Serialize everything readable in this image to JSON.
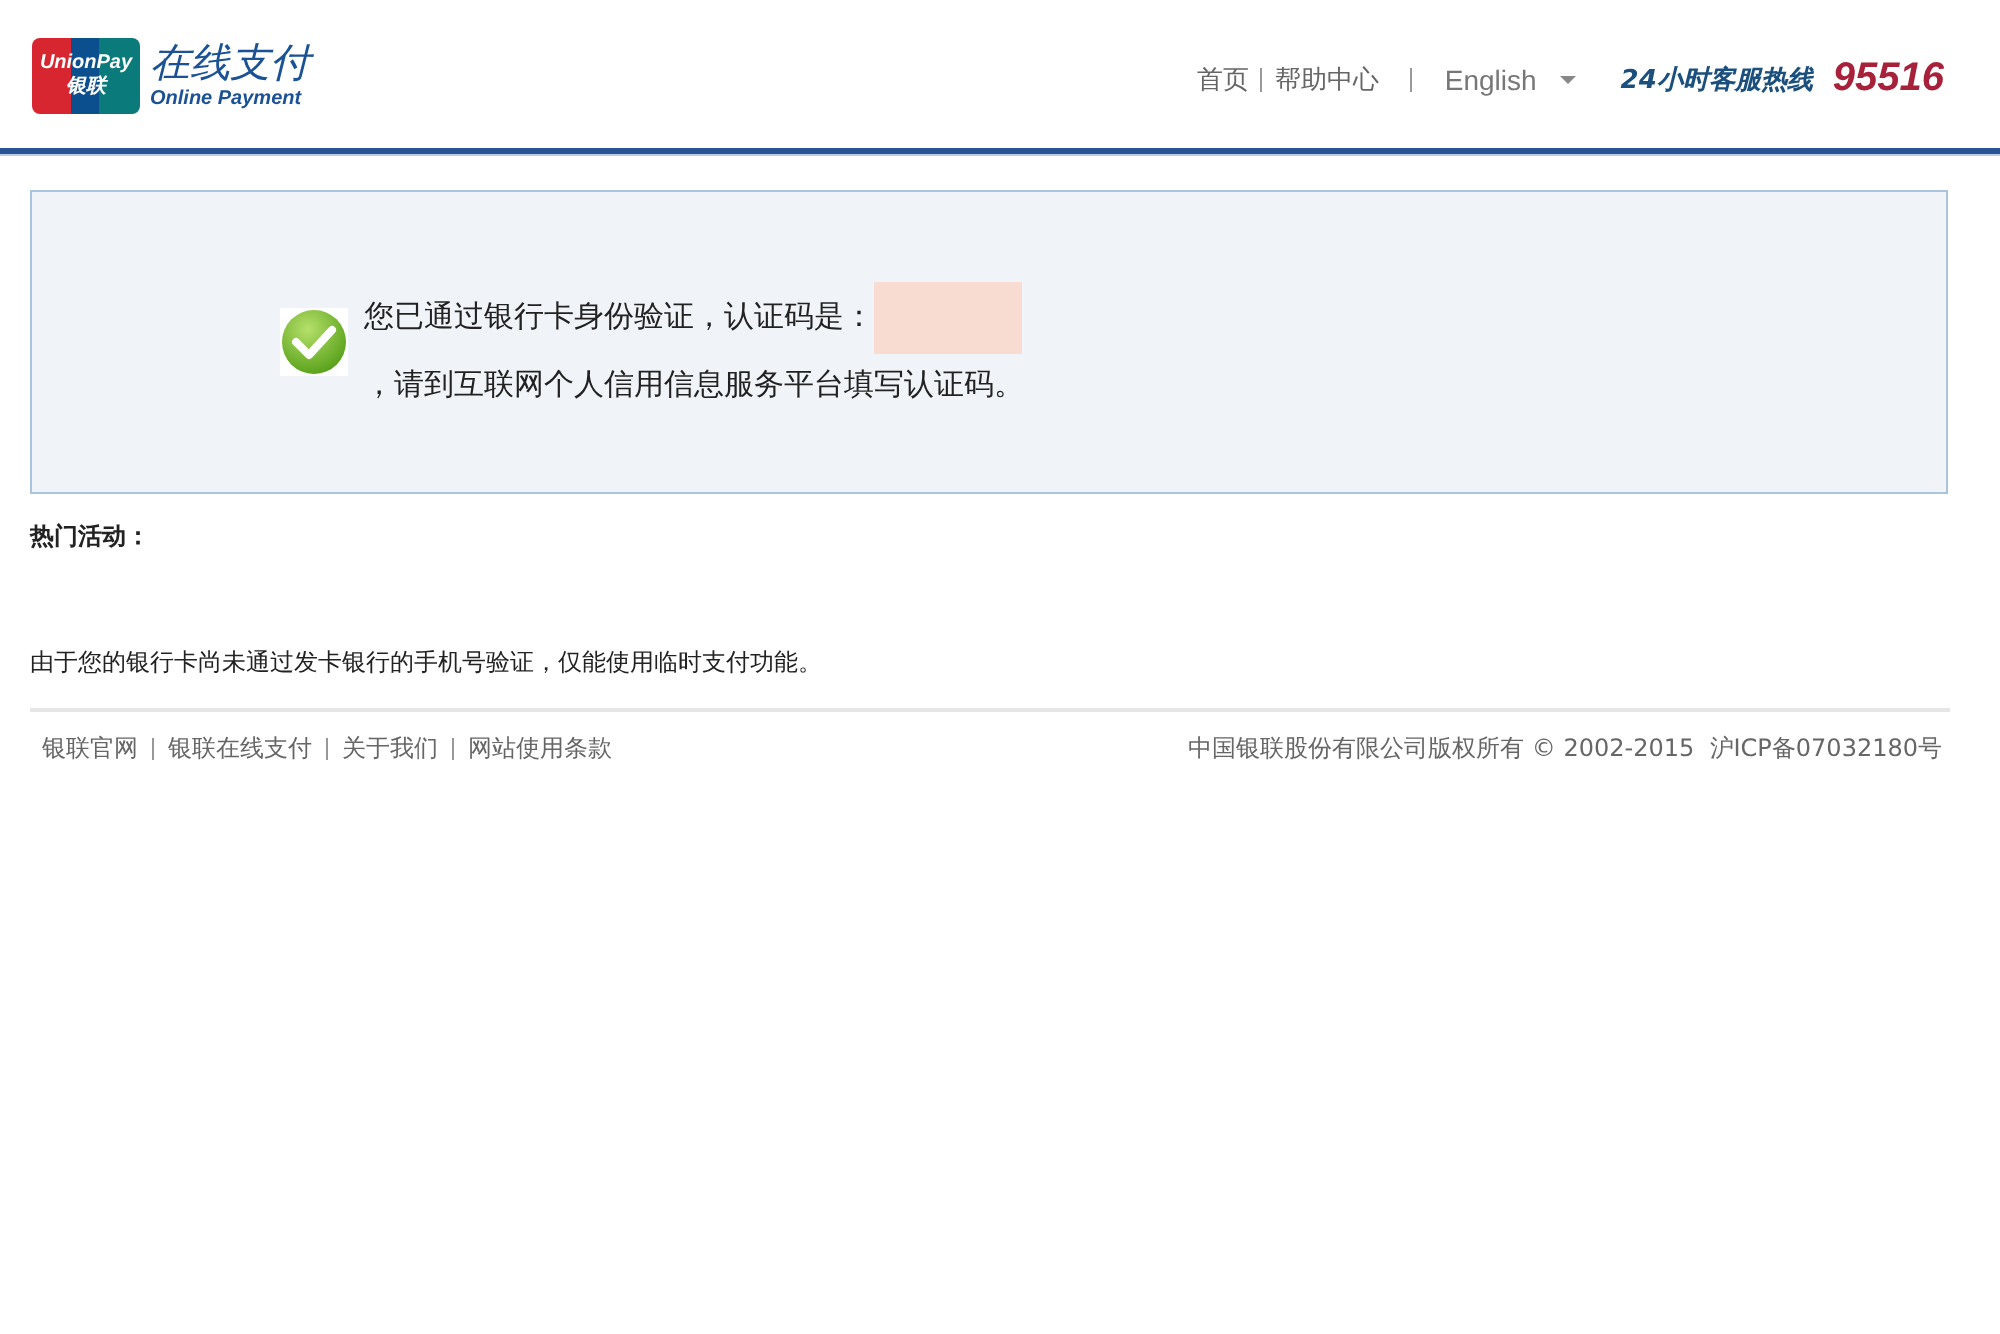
{
  "header": {
    "logo": {
      "card_latin": "UnionPay",
      "card_cjk": "银联",
      "title": "在线支付",
      "subtitle": "Online Payment"
    },
    "nav": [
      {
        "label": "首页"
      },
      {
        "label": "帮助中心"
      }
    ],
    "language": "English",
    "hotline": {
      "label": "24小时客服热线",
      "number": "95516"
    }
  },
  "message": {
    "line1": "您已通过银行卡身份验证，认证码是：",
    "line2": "，请到互联网个人信用信息服务平台填写认证码。"
  },
  "promotions_label": "热门活动：",
  "notice": "由于您的银行卡尚未通过发卡银行的手机号验证，仅能使用临时支付功能。",
  "footer": {
    "links": [
      {
        "label": "银联官网"
      },
      {
        "label": "银联在线支付"
      },
      {
        "label": "关于我们"
      },
      {
        "label": "网站使用条款"
      }
    ],
    "copyright": "中国银联股份有限公司版权所有 © 2002-2015  沪ICP备07032180号"
  }
}
